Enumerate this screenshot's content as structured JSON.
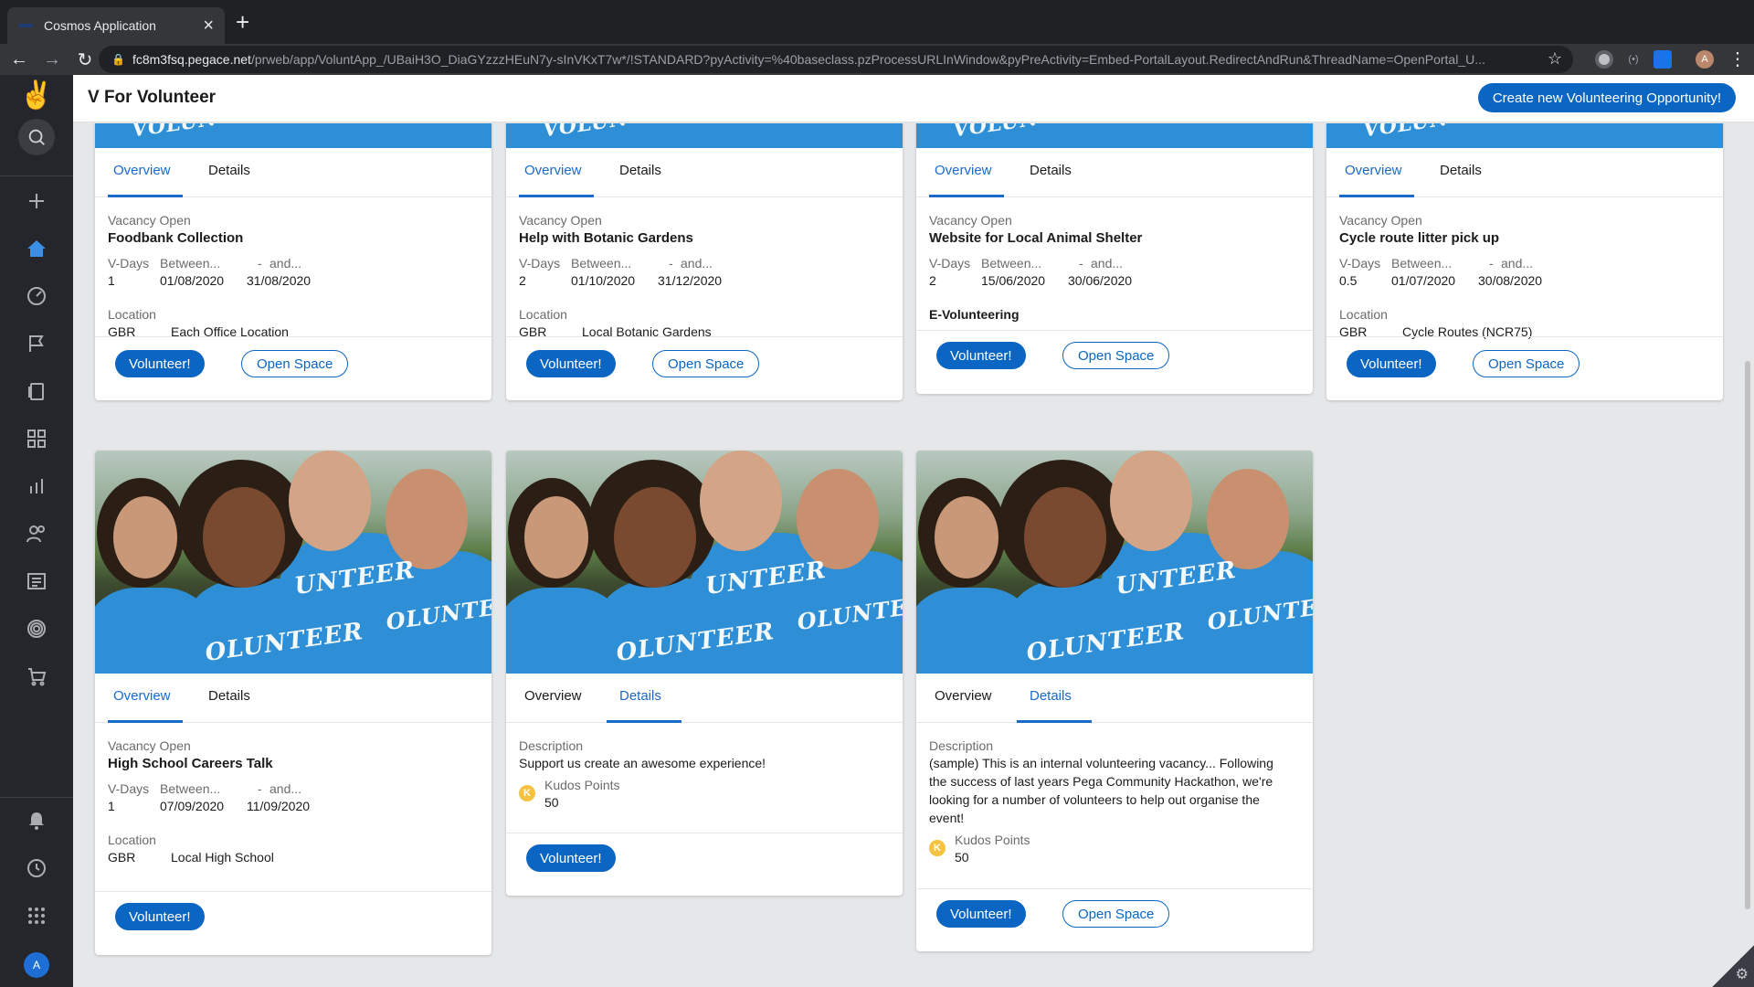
{
  "browser": {
    "tab_title": "Cosmos Application",
    "url_host": "fc8m3fsq.pegace.net",
    "url_path": "/prweb/app/VoluntApp_/UBaiH3O_DiaGYzzzHEuN7y-sInVKxT7w*/!STANDARD?pyActivity=%40baseclass.pzProcessURLInWindow&pyPreActivity=Embed-PortalLayout.RedirectAndRun&ThreadName=OpenPortal_U...",
    "profile_initial": "A"
  },
  "header": {
    "title": "V For Volunteer",
    "create_label": "Create new Volunteering Opportunity!"
  },
  "nav": {
    "user_initial": "A"
  },
  "labels": {
    "tab_overview": "Overview",
    "tab_details": "Details",
    "vacancy_open": "Vacancy Open",
    "v_days": "V-Days",
    "between": "Between...",
    "dash": "-",
    "and": "and...",
    "location": "Location",
    "description": "Description",
    "kudos_points": "Kudos Points",
    "volunteer": "Volunteer!",
    "open_space": "Open Space",
    "kudos_badge": "K"
  },
  "cards": [
    {
      "title": "Foodbank Collection",
      "vdays": "1",
      "start": "01/08/2020",
      "end": "31/08/2020",
      "country": "GBR",
      "place": "Each Office Location"
    },
    {
      "title": "Help with Botanic Gardens",
      "vdays": "2",
      "start": "01/10/2020",
      "end": "31/12/2020",
      "country": "GBR",
      "place": "Local Botanic Gardens"
    },
    {
      "title": "Website for Local Animal Shelter",
      "vdays": "2",
      "start": "15/06/2020",
      "end": "30/06/2020",
      "tag": "E-Volunteering"
    },
    {
      "title": "Cycle route litter pick up",
      "vdays": "0.5",
      "start": "01/07/2020",
      "end": "30/08/2020",
      "country": "GBR",
      "place": "Cycle Routes (NCR75)"
    },
    {
      "title": "High School Careers Talk",
      "vdays": "1",
      "start": "07/09/2020",
      "end": "11/09/2020",
      "country": "GBR",
      "place": "Local High School"
    },
    {
      "description": "Support us create an awesome experience!",
      "kudos": "50"
    },
    {
      "description_lines": [
        "(sample) This is an internal volunteering vacancy... Following",
        "the success of last years Pega Community Hackathon, we're",
        "looking for a number of volunteers to help out organise the",
        "event!"
      ],
      "kudos": "50"
    }
  ],
  "photo_text": {
    "a": "UNTEER",
    "b": "OLUNTEER",
    "c": "OLUNTEER",
    "d": "VOLUN"
  }
}
